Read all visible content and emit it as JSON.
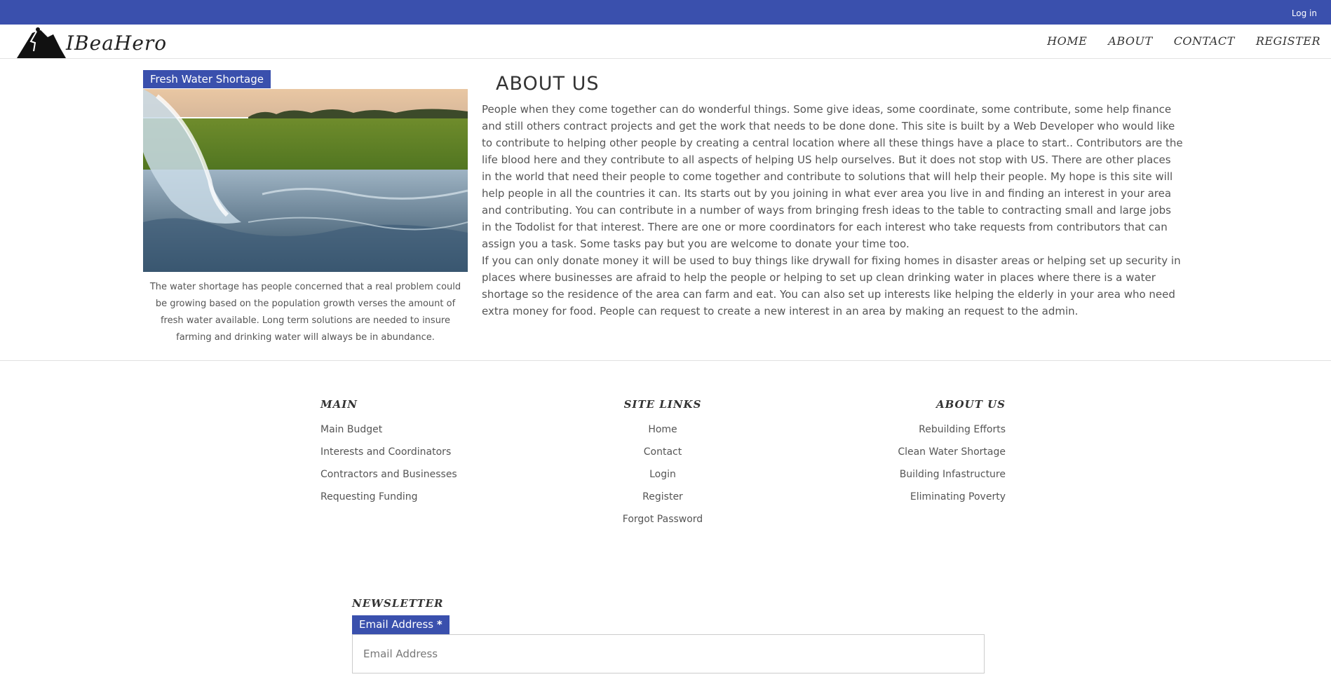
{
  "topbar": {
    "login_label": "Log in"
  },
  "brand": {
    "name": "IBeaHero"
  },
  "nav": {
    "items": [
      {
        "label": "HOME"
      },
      {
        "label": "ABOUT"
      },
      {
        "label": "CONTACT"
      },
      {
        "label": "REGISTER"
      }
    ]
  },
  "card": {
    "tag": "Fresh Water Shortage",
    "caption": "The water shortage has people concerned that a real problem could be growing based on the population growth verses the amount of fresh water available. Long term solutions are needed to insure farming and drinking water will always be in abundance."
  },
  "about": {
    "title": "ABOUT US",
    "paragraph1": "People when they come together can do wonderful things. Some give ideas, some coordinate, some contribute, some help finance and still others contract projects and get the work that needs to be done done. This site is built by a Web Developer who would like to contribute to helping other people by creating a central location where all these things have a place to start.. Contributors are the life blood here and they contribute to all aspects of helping US help ourselves. But it does not stop with US. There are other places in the world that need their people to come together and contribute to solutions that will help their people. My hope is this site will help people in all the countries it can. Its starts out by you joining in what ever area you live in and finding an interest in your area and contributing. You can contribute in a number of ways from bringing fresh ideas to the table to contracting small and large jobs in the Todolist for that interest. There are one or more coordinators for each interest who take requests from contributors that can assign you a task. Some tasks pay but you are welcome to donate your time too.",
    "paragraph2": "If you can only donate money it will be used to buy things like drywall for fixing homes in disaster areas or helping set up security in places where businesses are afraid to help the people or helping to set up clean drinking water in places where there is a water shortage so the residence of the area can farm and eat. You can also set up interests like helping the elderly in your area who need extra money for food. People can request to create a new interest in an area by making an request to the admin."
  },
  "footer": {
    "main": {
      "title": "MAIN",
      "links": [
        "Main Budget",
        "Interests and Coordinators",
        "Contractors and Businesses",
        "Requesting Funding"
      ]
    },
    "site_links": {
      "title": "SITE LINKS",
      "links": [
        "Home",
        "Contact",
        "Login",
        "Register",
        "Forgot Password"
      ]
    },
    "about": {
      "title": "ABOUT US",
      "links": [
        "Rebuilding Efforts",
        "Clean Water Shortage",
        "Building Infastructure",
        "Eliminating Poverty"
      ]
    }
  },
  "newsletter": {
    "title": "NEWSLETTER",
    "email_label": "Email Address",
    "required_mark": "*",
    "email_placeholder": "Email Address",
    "email_value": ""
  },
  "colors": {
    "brand_blue": "#3a50ad"
  }
}
